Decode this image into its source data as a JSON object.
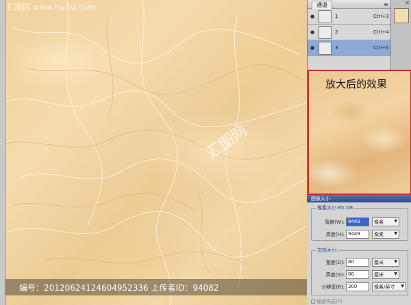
{
  "watermark": {
    "site": "汇图网 www.huitu.com"
  },
  "caption": {
    "text": "编号：20120624124604952336 上传者ID：94082"
  },
  "channels": {
    "tab": "通道",
    "menu_icon": "menu-icon",
    "rows": [
      {
        "name": "1",
        "shortcut": "Ctrl+3",
        "selected": false
      },
      {
        "name": "2",
        "shortcut": "Ctrl+4",
        "selected": false
      },
      {
        "name": "3",
        "shortcut": "Ctrl+5",
        "selected": true
      }
    ]
  },
  "zoom": {
    "label": "放大后的效果"
  },
  "dialog": {
    "title": "图像大小",
    "pixel_group": "像素大小:85.1M",
    "width_label": "宽度(W):",
    "width_value": "9449",
    "width_unit": "像素",
    "height_label": "高度(H):",
    "height_value": "9449",
    "height_unit": "像素",
    "doc_group": "文档大小:",
    "doc_width_label": "宽度(D):",
    "doc_width_value": "80",
    "doc_width_unit": "厘米",
    "doc_height_label": "高度(G):",
    "doc_height_value": "80",
    "doc_height_unit": "厘米",
    "res_label": "分辨率(R):",
    "res_value": "300",
    "res_unit": "像素/英寸",
    "constrain": "缩放样式(Y)"
  },
  "colors": {
    "marble": "#f0d29c",
    "zoom_border": "#c0302b",
    "selected_channel": "#8eaad6"
  }
}
